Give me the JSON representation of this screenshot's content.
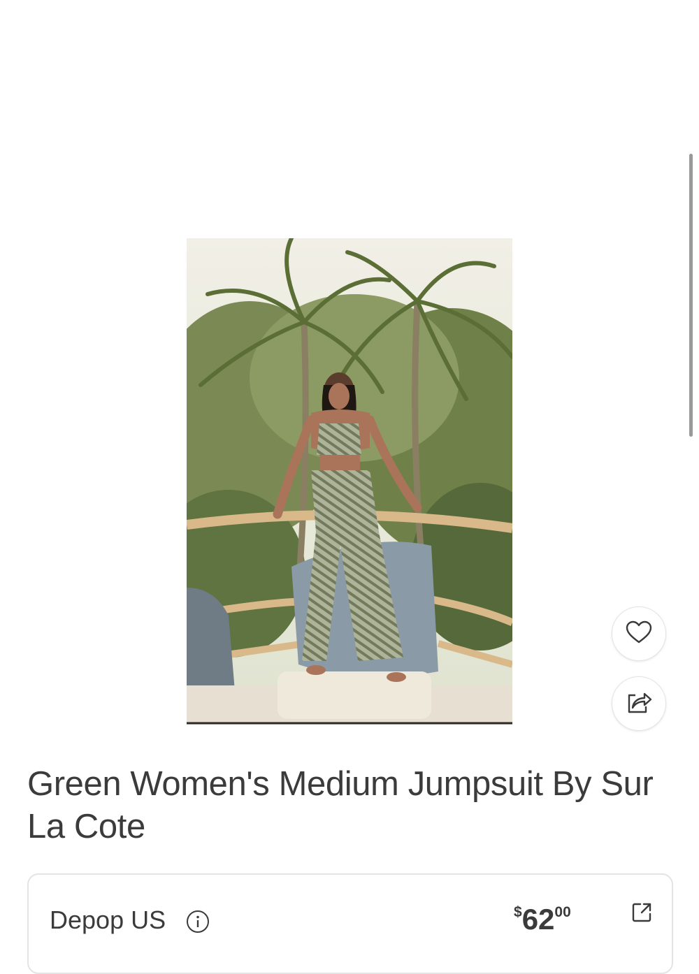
{
  "product": {
    "title": "Green Women's Medium Jumpsuit By Sur La Cote",
    "image_alt": "Model wearing a green striped halter jumpsuit on a balcony with palm trees"
  },
  "actions": {
    "like_icon": "heart-icon",
    "share_icon": "share-icon"
  },
  "offer": {
    "seller": "Depop US",
    "info_icon": "info-icon",
    "price_symbol": "$",
    "price_whole": "62",
    "price_cents": "00",
    "external_icon": "external-link-icon"
  },
  "colors": {
    "text": "#3b3b3b",
    "border": "#e4e4e4",
    "background": "#ffffff"
  }
}
